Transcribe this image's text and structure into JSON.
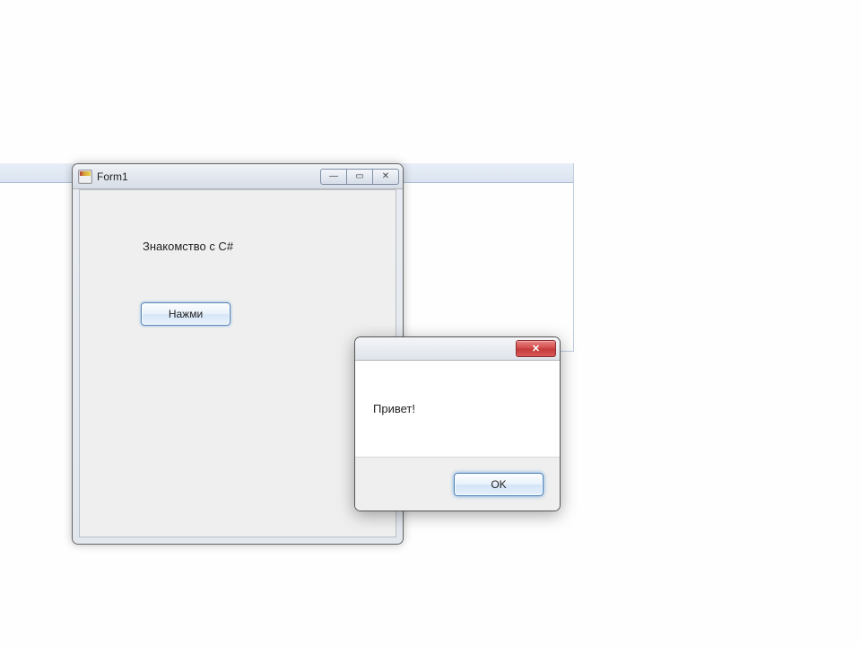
{
  "form": {
    "title": "Form1",
    "label": "Знакомство с C#",
    "button": "Нажми",
    "controls": {
      "minimize": "—",
      "maximize": "▭",
      "close": "✕"
    }
  },
  "messagebox": {
    "text": "Привет!",
    "ok": "OK",
    "close": "✕"
  }
}
